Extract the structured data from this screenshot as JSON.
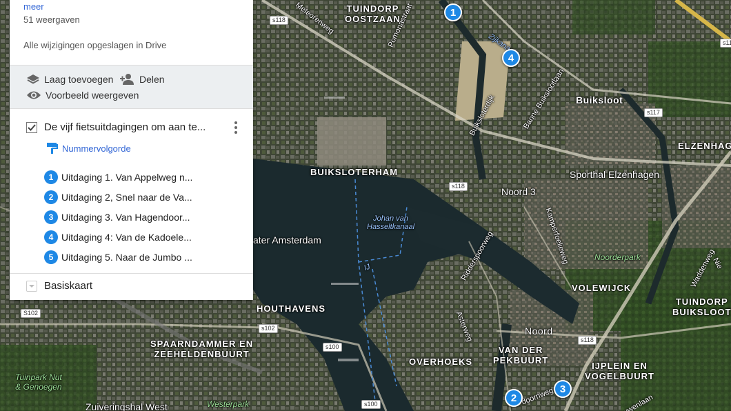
{
  "panel": {
    "more_link": "meer",
    "views": "51 weergaven",
    "saved_status": "Alle wijzigingen opgeslagen in Drive",
    "actions": {
      "add_layer": "Laag toevoegen",
      "share": "Delen",
      "preview": "Voorbeeld weergeven"
    },
    "layer": {
      "title": "De vijf fietsuitdagingen om aan te...",
      "checked": true,
      "style_link": "Nummervolgorde",
      "items": [
        {
          "num": "1",
          "label": "Uitdaging 1. Van Appelweg n..."
        },
        {
          "num": "2",
          "label": "Uitdaging 2, Snel naar de Va..."
        },
        {
          "num": "3",
          "label": "Uitdaging 3. Van Hagendoor..."
        },
        {
          "num": "4",
          "label": "Uitdaging 4: Van de Kadoele..."
        },
        {
          "num": "5",
          "label": "Uitdaging 5. Naar de Jumbo ..."
        }
      ]
    },
    "basemap": "Basiskaart"
  },
  "map": {
    "markers": [
      "1",
      "4",
      "2",
      "3"
    ],
    "labels": {
      "tuindorp_oostzaan": "TUINDORP\nOOSTZAAN",
      "buiksloterham": "BUIKSLOTERHAM",
      "buiksloot": "Buiksloot",
      "elzenhagen": "ELZENHAGEN",
      "sporthal": "Sporthal Elzenhagen",
      "noord3": "Noord 3",
      "noorderpark": "Noorderpark",
      "volewijck": "VOLEWIJCK",
      "tuindorp_buiksloot": "TUINDORP\nBUIKSLOOT",
      "houthavens": "HOUTHAVENS",
      "spaarndammer": "SPAARNDAMMER EN\nZEEHELDENBUURT",
      "overhoeks": "OVERHOEKS",
      "van_der_pekbuurt": "VAN DER\nPEKBUURT",
      "noord": "Noord",
      "ijplein": "IJPLEIN EN\nVOGELBUURT",
      "tuinpark": "Tuinpark Nut\n& Genoegen",
      "zuiveringshal": "Zuiveringshal West",
      "westerpark": "Westerpark",
      "ater_amsterdam": "ater Amsterdam",
      "hasselt": "Johan van\nHasseltkanaal",
      "pomonastraat": "Pomonastraat",
      "meteorenweg": "Meteorenweg",
      "buiksloterdijk": "Buiksloterdijk",
      "banne": "Banne Buikslootlaan",
      "ridderspoorweg": "Ridderspoorweg",
      "kamperfoelieweg": "Kamperfoelieweg",
      "asterweg": "Asterweg",
      "hagendoornweg": "doornweg",
      "waddenweg": "Waddenweg",
      "nieuwe": "Nie",
      "zijkanaal": "Zijkanaal I",
      "meeuwenlaan": "euwenlaan",
      "ijtunnel": "IJ"
    },
    "roads": [
      "s118",
      "s118",
      "s117",
      "s118",
      "s100",
      "s100",
      "s102",
      "S102",
      "s118"
    ]
  },
  "colors": {
    "accent": "#3367d6",
    "marker": "#1e88e5"
  }
}
